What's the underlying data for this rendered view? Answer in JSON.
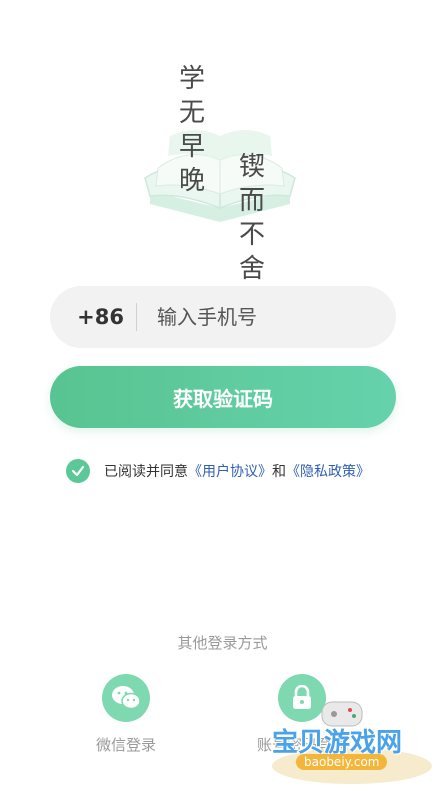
{
  "hero": {
    "line_left": "学无早晚",
    "line_right": "锲而不舍"
  },
  "phone": {
    "country_code": "+86",
    "placeholder": "输入手机号"
  },
  "primary_button": {
    "label": "获取验证码"
  },
  "agreement": {
    "checked": true,
    "text_prefix": "已阅读并同意",
    "user_agreement": "《用户协议》",
    "and": "和",
    "privacy_policy": "《隐私政策》"
  },
  "other_login": {
    "title": "其他登录方式",
    "options": [
      {
        "label": "微信登录",
        "icon": "wechat-icon"
      },
      {
        "label": "账号密码登录",
        "icon": "lock-icon"
      }
    ]
  },
  "watermark": {
    "title": "宝贝游戏网",
    "url": "baobeiy.com"
  },
  "colors": {
    "accent": "#5cc897",
    "link": "#2f5fb5",
    "muted": "#999999"
  }
}
